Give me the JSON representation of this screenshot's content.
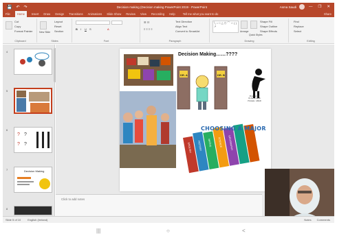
{
  "window": {
    "title": "Decision making (Decision making PowerPoint 2019 - PowerPoint",
    "user": "Asma Saudi",
    "controls": [
      "—",
      "❐",
      "✕"
    ]
  },
  "tabs": [
    {
      "label": "File"
    },
    {
      "label": "Home",
      "active": true
    },
    {
      "label": "Insert"
    },
    {
      "label": "Draw"
    },
    {
      "label": "Design"
    },
    {
      "label": "Transitions"
    },
    {
      "label": "Animations"
    },
    {
      "label": "Slide Show"
    },
    {
      "label": "Review"
    },
    {
      "label": "View"
    },
    {
      "label": "Recording"
    },
    {
      "label": "Help"
    }
  ],
  "tell_me": "Tell me what you want to do",
  "share": "Share",
  "ribbon": {
    "clipboard": {
      "cut": "Cut",
      "copy": "Copy",
      "format_painter": "Format Painter",
      "label": "Clipboard"
    },
    "slides": {
      "new_slide": "New Slide",
      "layout": "Layout",
      "reset": "Reset",
      "section": "Section",
      "label": "Slides"
    },
    "font": {
      "label": "Font"
    },
    "paragraph": {
      "text_direction": "Text Direction",
      "align_text": "Align Text",
      "convert": "Convert to SmartArt",
      "label": "Paragraph"
    },
    "drawing": {
      "arrange": "Arrange",
      "quick_styles": "Quick Styles",
      "shape_fill": "Shape Fill",
      "shape_outline": "Shape Outline",
      "shape_effects": "Shape Effects",
      "label": "Drawing"
    },
    "editing": {
      "find": "Find",
      "replace": "Replace",
      "select": "Select",
      "label": "Editing"
    }
  },
  "slide": {
    "title": "Decision Making……????",
    "door_a": "DR. A",
    "door_b": "DR. B",
    "prepared": [
      "Prepared By",
      "Dr.Asma Saudi",
      "Principle : AMAD"
    ],
    "choosing": "CHOOSING A MAJOR",
    "book_labels": [
      "ENGLISH",
      "HISTORY",
      "MATHS",
      "SCIENCE",
      "GEOGRAPHY"
    ]
  },
  "thumbnails": [
    {
      "num": "4"
    },
    {
      "num": "5",
      "selected": true
    },
    {
      "num": "6"
    },
    {
      "num": "7",
      "title": "Decision Making"
    },
    {
      "num": "8"
    }
  ],
  "notes_placeholder": "Click to add notes",
  "status": {
    "slide": "Slide 5 of 10",
    "language": "English (Ireland)",
    "notes": "Notes",
    "comments": "Comments"
  },
  "nav": {
    "recent": "|||",
    "home": "○",
    "back": "<"
  },
  "colors": {
    "accent": "#b7472a",
    "selection": "#c43e1c"
  }
}
